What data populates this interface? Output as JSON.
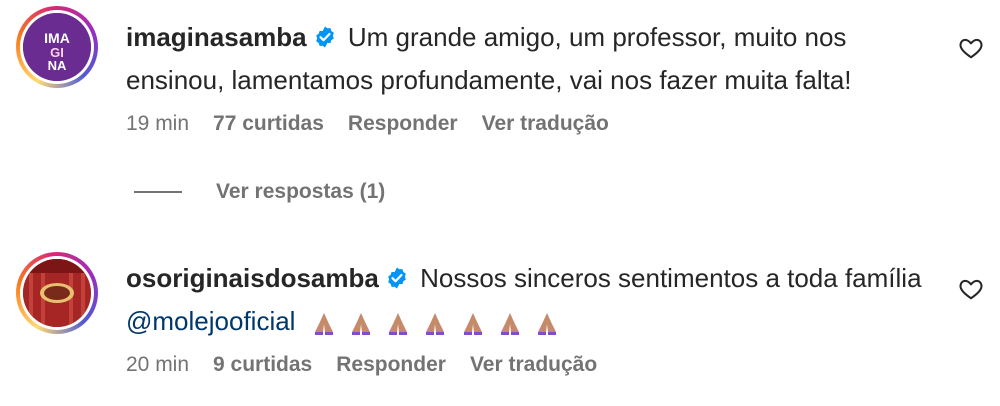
{
  "comments": [
    {
      "username": "imaginasamba",
      "avatar_label": "IMAGINA",
      "text": "Um grande amigo, um professor, muito nos ensinou, lamentamos profundamente, vai nos fazer muita falta!",
      "time": "19 min",
      "likes": "77 curtidas",
      "reply": "Responder",
      "translate": "Ver tradução"
    },
    {
      "username": "osoriginaisdosamba",
      "text_before": "Nossos sinceros sentimentos a toda família",
      "mention": "@molejooficial",
      "emoji": "🙏🏽🙏🏽🙏🏽🙏🏽🙏🏽🙏🏽🙏🏽",
      "time": "20 min",
      "likes": "9 curtidas",
      "reply": "Responder",
      "translate": "Ver tradução"
    }
  ],
  "replies": {
    "label": "Ver respostas (1)"
  },
  "icons": {
    "verified": "verified-badge-icon",
    "like": "heart-icon"
  },
  "colors": {
    "verified": "#0095f6",
    "mention": "#00376b",
    "secondary": "#737373"
  }
}
